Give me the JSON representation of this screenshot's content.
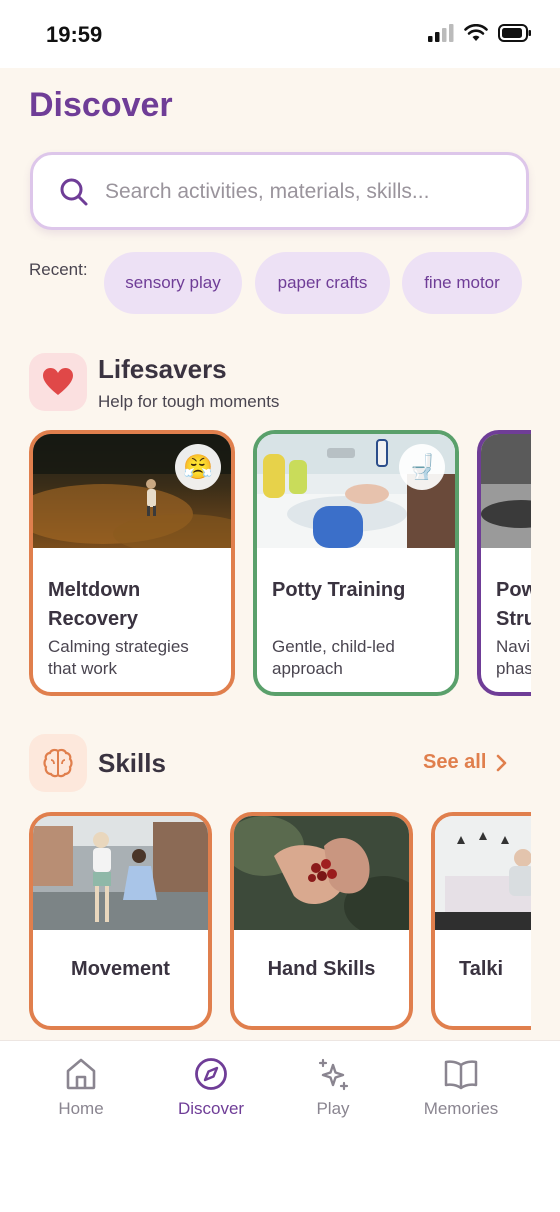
{
  "status_bar": {
    "time": "19:59"
  },
  "page": {
    "title": "Discover"
  },
  "search": {
    "placeholder": "Search activities, materials, skills..."
  },
  "recent": {
    "label": "Recent:",
    "chips": [
      "sensory play",
      "paper crafts",
      "fine motor"
    ]
  },
  "lifesavers": {
    "title": "Lifesavers",
    "subtitle": "Help for tough moments",
    "cards": [
      {
        "title_line1": "Meltdown",
        "title_line2": "Recovery",
        "desc_line1": "Calming strategies",
        "desc_line2": "that work",
        "badge": "😤",
        "color": "#e07f4d"
      },
      {
        "title_line1": "Potty Training",
        "title_line2": "",
        "desc_line1": "Gentle, child-led",
        "desc_line2": "approach",
        "badge": "🚽",
        "color": "#5aa06b"
      },
      {
        "title_line1": "Pow",
        "title_line2": "Stru",
        "desc_line1": "Navi",
        "desc_line2": "phas",
        "color": "#6f3d97"
      }
    ]
  },
  "skills": {
    "title": "Skills",
    "see_all": "See all",
    "items": [
      {
        "label": "Movement"
      },
      {
        "label": "Hand Skills"
      },
      {
        "label": "Talki"
      }
    ]
  },
  "tabbar": {
    "tabs": [
      {
        "label": "Home",
        "icon": "home-icon"
      },
      {
        "label": "Discover",
        "icon": "compass-icon",
        "active": true
      },
      {
        "label": "Play",
        "icon": "sparkles-icon"
      },
      {
        "label": "Memories",
        "icon": "book-icon"
      }
    ]
  },
  "colors": {
    "brand_purple": "#6f3d97",
    "accent_orange": "#e07f4d",
    "accent_green": "#5aa06b",
    "chip_bg": "#ede1f5",
    "background": "#fcf6ee"
  }
}
